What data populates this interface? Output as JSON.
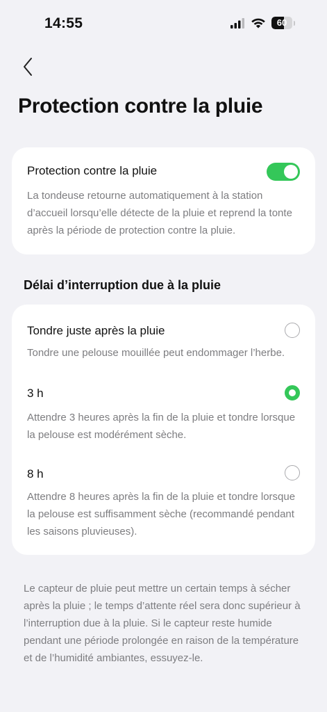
{
  "status_bar": {
    "time": "14:55",
    "battery_level": "60",
    "battery_fraction": 0.6,
    "icons": [
      "cellular-signal-icon",
      "wifi-icon",
      "battery-icon"
    ]
  },
  "header": {
    "back_icon": "chevron-left-icon",
    "title": "Protection contre la pluie"
  },
  "rain_protection": {
    "label": "Protection contre la pluie",
    "enabled": true,
    "description": "La tondeuse retourne automatiquement à la station d’accueil lorsqu’elle détecte de la pluie et reprend la tonte après la période de protection contre la pluie."
  },
  "delay_section": {
    "title": "Délai d’interruption due à la pluie",
    "options": [
      {
        "label": "Tondre juste après la pluie",
        "description": "Tondre une pelouse mouillée peut endommager l’herbe.",
        "selected": false
      },
      {
        "label": "3 h",
        "description": "Attendre 3 heures après la fin de la pluie et tondre lorsque la pelouse est modérément sèche.",
        "selected": true
      },
      {
        "label": "8 h",
        "description": "Attendre 8 heures après la fin de la pluie et tondre lorsque la pelouse est suffisamment sèche (recommandé pendant les saisons pluvieuses).",
        "selected": false
      }
    ]
  },
  "footer_note": "Le capteur de pluie peut mettre un certain temps à sécher après la pluie ; le temps d’attente réel sera donc supérieur à l’interruption due à la pluie. Si le capteur reste humide pendant une période prolongée en raison de la température et de l’humidité ambiantes, essuyez-le.",
  "colors": {
    "accent_green": "#34c759",
    "background": "#f2f2f6",
    "card": "#ffffff",
    "secondary_text": "#7d7d80"
  }
}
